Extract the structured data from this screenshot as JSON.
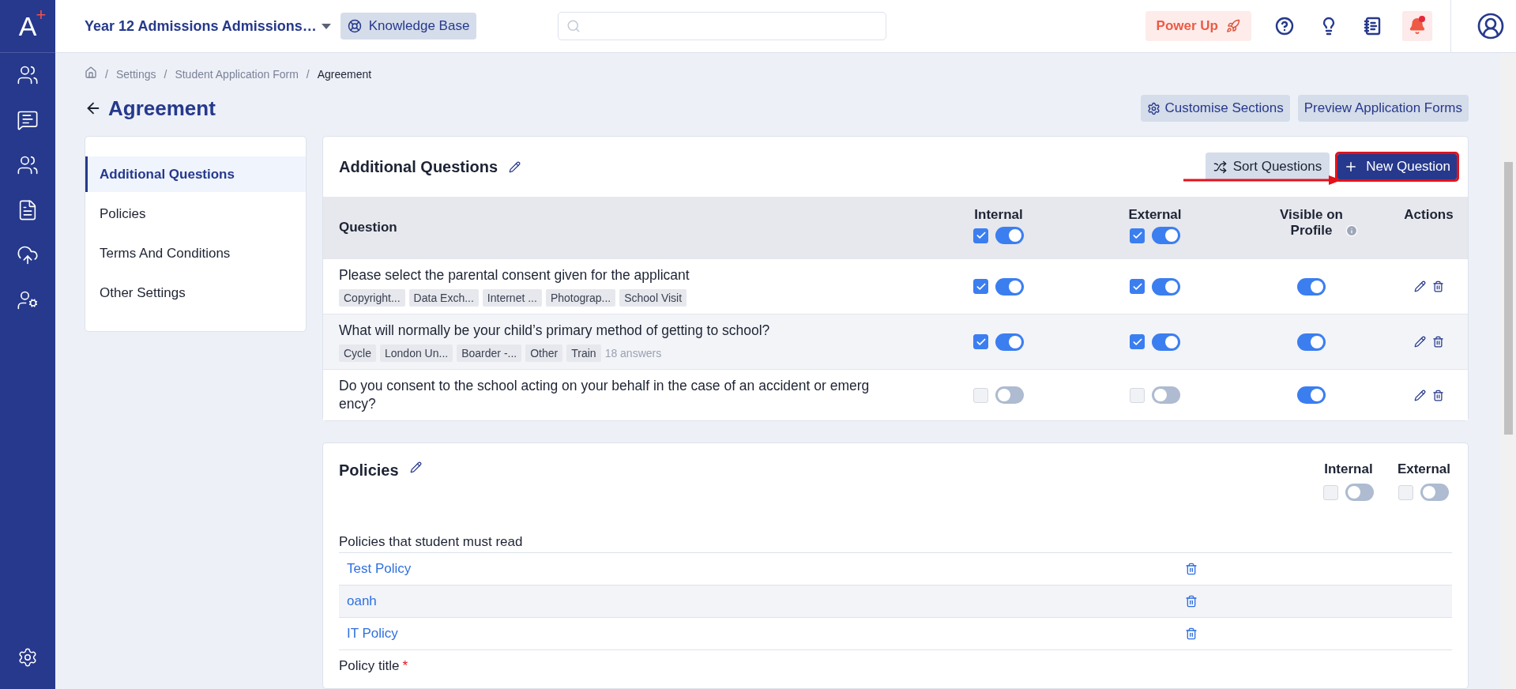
{
  "logo": {
    "letter": "A",
    "mark": "+"
  },
  "header": {
    "project": "Year 12 Admissions Admissions…",
    "knowledge_base": "Knowledge Base",
    "power_up": "Power Up",
    "notifications": {
      "unread": true
    }
  },
  "breadcrumb": {
    "separator": "/",
    "items": [
      "Settings",
      "Student Application Form",
      "Agreement"
    ]
  },
  "page": {
    "title": "Agreement",
    "actions": [
      "Customise Sections",
      "Preview Application Forms"
    ]
  },
  "section_nav": [
    {
      "label": "Additional Questions",
      "selected": true
    },
    {
      "label": "Policies",
      "selected": false
    },
    {
      "label": "Terms And Conditions",
      "selected": false
    },
    {
      "label": "Other Settings",
      "selected": false
    }
  ],
  "questions": {
    "title": "Additional Questions",
    "sort_button": "Sort Questions",
    "new_button": {
      "label": "New Question",
      "highlighted": true
    },
    "columns": [
      "Question",
      "Internal",
      "External",
      "Visible on Profile",
      "Actions"
    ],
    "header_internal": {
      "checked": true,
      "on": true
    },
    "header_external": {
      "checked": true,
      "on": true
    },
    "rows": [
      {
        "question": "Please select the parental consent given for the applicant",
        "tags": [
          "Copyright...",
          "Data Exch...",
          "Internet ...",
          "Photograp...",
          "School Visit"
        ],
        "internal": {
          "checked": true,
          "on": true
        },
        "external": {
          "checked": true,
          "on": true
        },
        "visible": true
      },
      {
        "question": "What will normally be your child’s primary method of getting to school?",
        "tags": [
          "Cycle",
          "London Un...",
          "Boarder -...",
          "Other",
          "Train"
        ],
        "answers": "18 answers",
        "internal": {
          "checked": true,
          "on": true
        },
        "external": {
          "checked": true,
          "on": true
        },
        "visible": true
      },
      {
        "question": "Do you consent to the school acting on your behalf in the case of an accident or emergency?",
        "internal": {
          "checked": false,
          "on": false
        },
        "external": {
          "checked": false,
          "on": false
        },
        "visible": true
      }
    ]
  },
  "policies": {
    "title": "Policies",
    "columns": [
      {
        "label": "Internal",
        "checked": false,
        "on": false
      },
      {
        "label": "External",
        "checked": false,
        "on": false
      }
    ],
    "list_label": "Policies that student must read",
    "items": [
      "Test Policy",
      "oanh",
      "IT Policy"
    ],
    "field_label": "Policy title",
    "required_mark": "*"
  }
}
